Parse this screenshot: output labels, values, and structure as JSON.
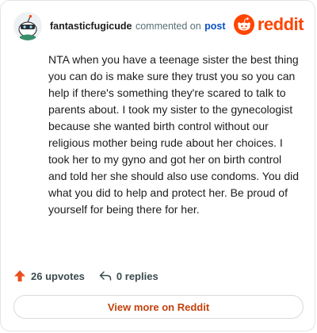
{
  "header": {
    "username": "fantasticfugicude",
    "commented_text": "commented on",
    "post_link": "post",
    "brand_word": "reddit",
    "avatar_icon": "snoo-avatar-icon",
    "brand_icon": "reddit-logo-icon"
  },
  "comment": {
    "body": "NTA when you have a teenage sister the best thing you can do is make sure they trust you so you can help if there's something they're scared to talk to parents about. I took my sister to the gynecologist because she wanted birth control without our religious mother being rude about her choices. I took her to my gyno and got her on birth control and told her she should also use condoms. You did what you did to help and protect her. Be proud of yourself for being there for her."
  },
  "actions": {
    "upvotes": "26 upvotes",
    "replies": "0 replies",
    "upvote_icon": "upvote-arrow-icon",
    "reply_icon": "reply-arrow-icon"
  },
  "footer": {
    "view_more": "View more on Reddit"
  },
  "colors": {
    "brand": "#ff4500",
    "link": "#0a4fc4",
    "view_more": "#c2410c"
  }
}
